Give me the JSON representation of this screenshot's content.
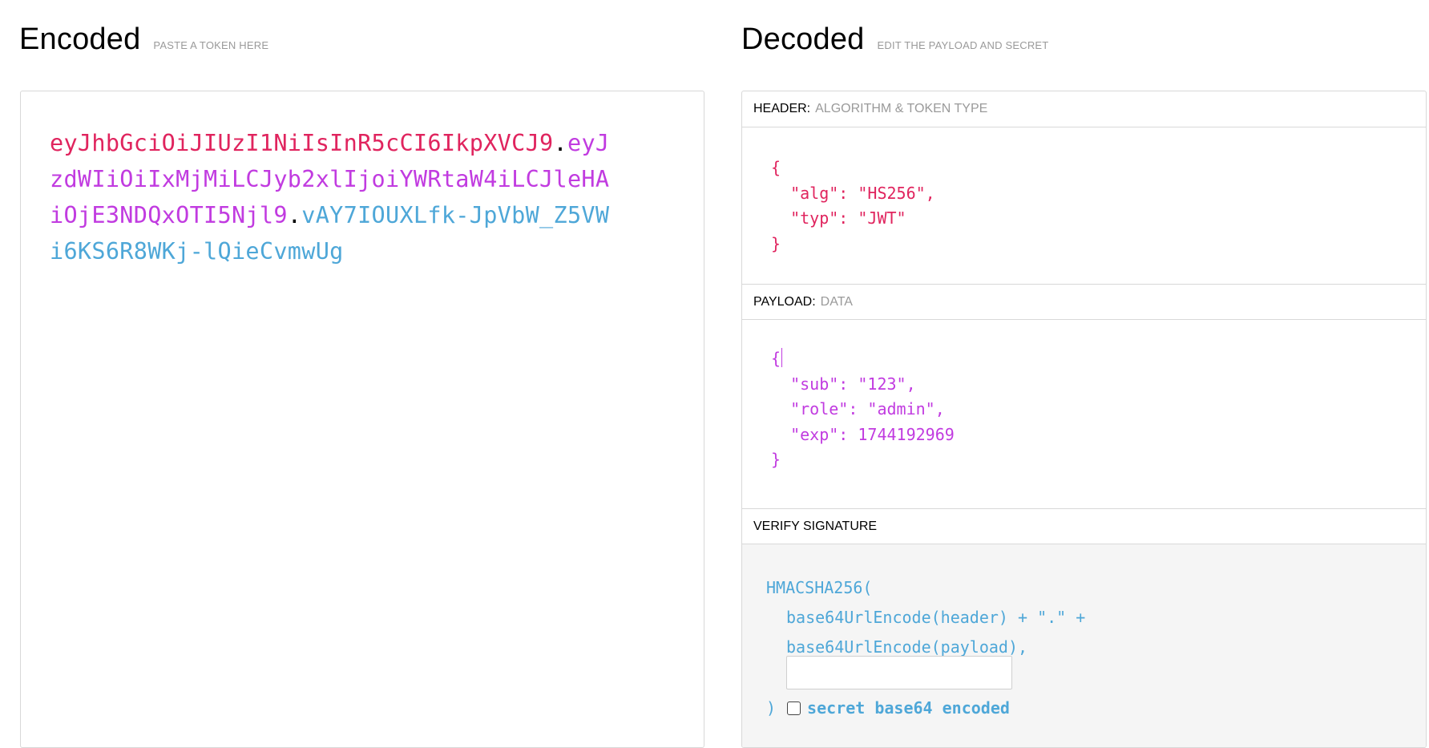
{
  "encoded": {
    "title": "Encoded",
    "subtitle": "PASTE A TOKEN HERE",
    "token": {
      "header_part": "eyJhbGciOiJIUzI1NiIsInR5cCI6IkpXVCJ9",
      "payload_part": "eyJzdWIiOiIxMjMiLCJyb2xlIjoiYWRtaW4iLCJleHAiOjE3NDQxOTI5Njl9",
      "signature_part": "vAY7IOUXLfk-JpVbW_Z5VWi6KS6R8WKj-lQieCvmwUg",
      "separator": "."
    }
  },
  "decoded": {
    "title": "Decoded",
    "subtitle": "EDIT THE PAYLOAD AND SECRET",
    "header": {
      "label": "HEADER:",
      "sublabel": "ALGORITHM & TOKEN TYPE",
      "json_lines": [
        "{",
        "  \"alg\": \"HS256\",",
        "  \"typ\": \"JWT\"",
        "}"
      ]
    },
    "payload": {
      "label": "PAYLOAD:",
      "sublabel": "DATA",
      "json_first": "{",
      "json_lines": [
        "  \"sub\": \"123\",",
        "  \"role\": \"admin\",",
        "  \"exp\": 1744192969",
        "}"
      ]
    },
    "verify": {
      "label": "VERIFY SIGNATURE",
      "fn": "HMACSHA256(",
      "line1": "base64UrlEncode(header) + \".\" +",
      "line2": "base64UrlEncode(payload),",
      "secret_value": "",
      "close_paren": ")",
      "checkbox_label": "secret base64 encoded",
      "checkbox_checked": false
    }
  },
  "colors": {
    "header": "#e0245e",
    "payload": "#c13be0",
    "signature": "#4ea7d8"
  }
}
